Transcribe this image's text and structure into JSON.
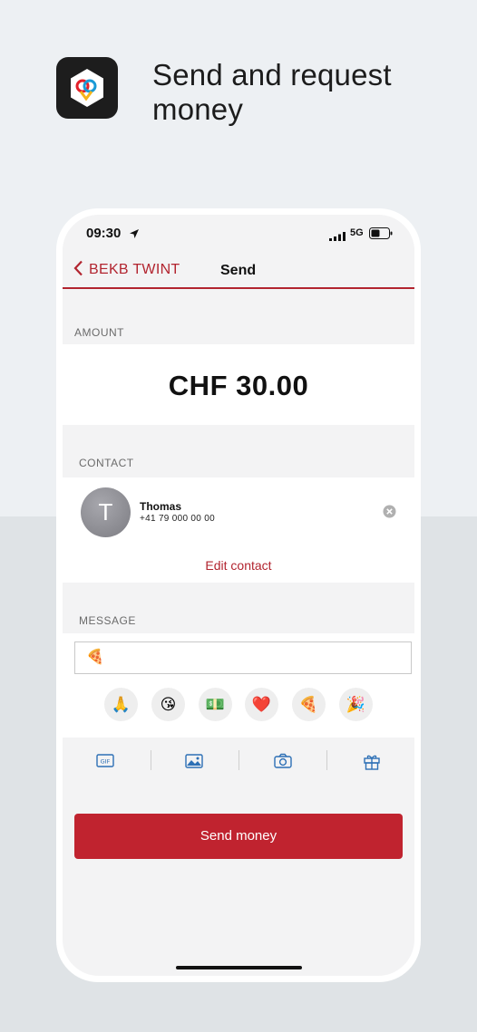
{
  "headline": "Send and request money",
  "status_bar": {
    "time": "09:30",
    "network": "5G"
  },
  "nav": {
    "back_label": "BEKB TWINT",
    "title": "Send"
  },
  "amount": {
    "section_label": "AMOUNT",
    "value": "CHF 30.00"
  },
  "contact": {
    "section_label": "CONTACT",
    "avatar_initial": "T",
    "name": "Thomas",
    "phone": "+41 79 000 00 00",
    "edit_label": "Edit contact"
  },
  "message": {
    "section_label": "MESSAGE",
    "value": "🍕",
    "emoji_options": [
      "🙏",
      "😘",
      "💵",
      "❤️",
      "🍕",
      "🎉"
    ]
  },
  "attachments": [
    "gif-icon",
    "image-icon",
    "camera-icon",
    "gift-icon"
  ],
  "send_button_label": "Send money",
  "colors": {
    "accent": "#c0232f",
    "background": "#edf0f3"
  }
}
